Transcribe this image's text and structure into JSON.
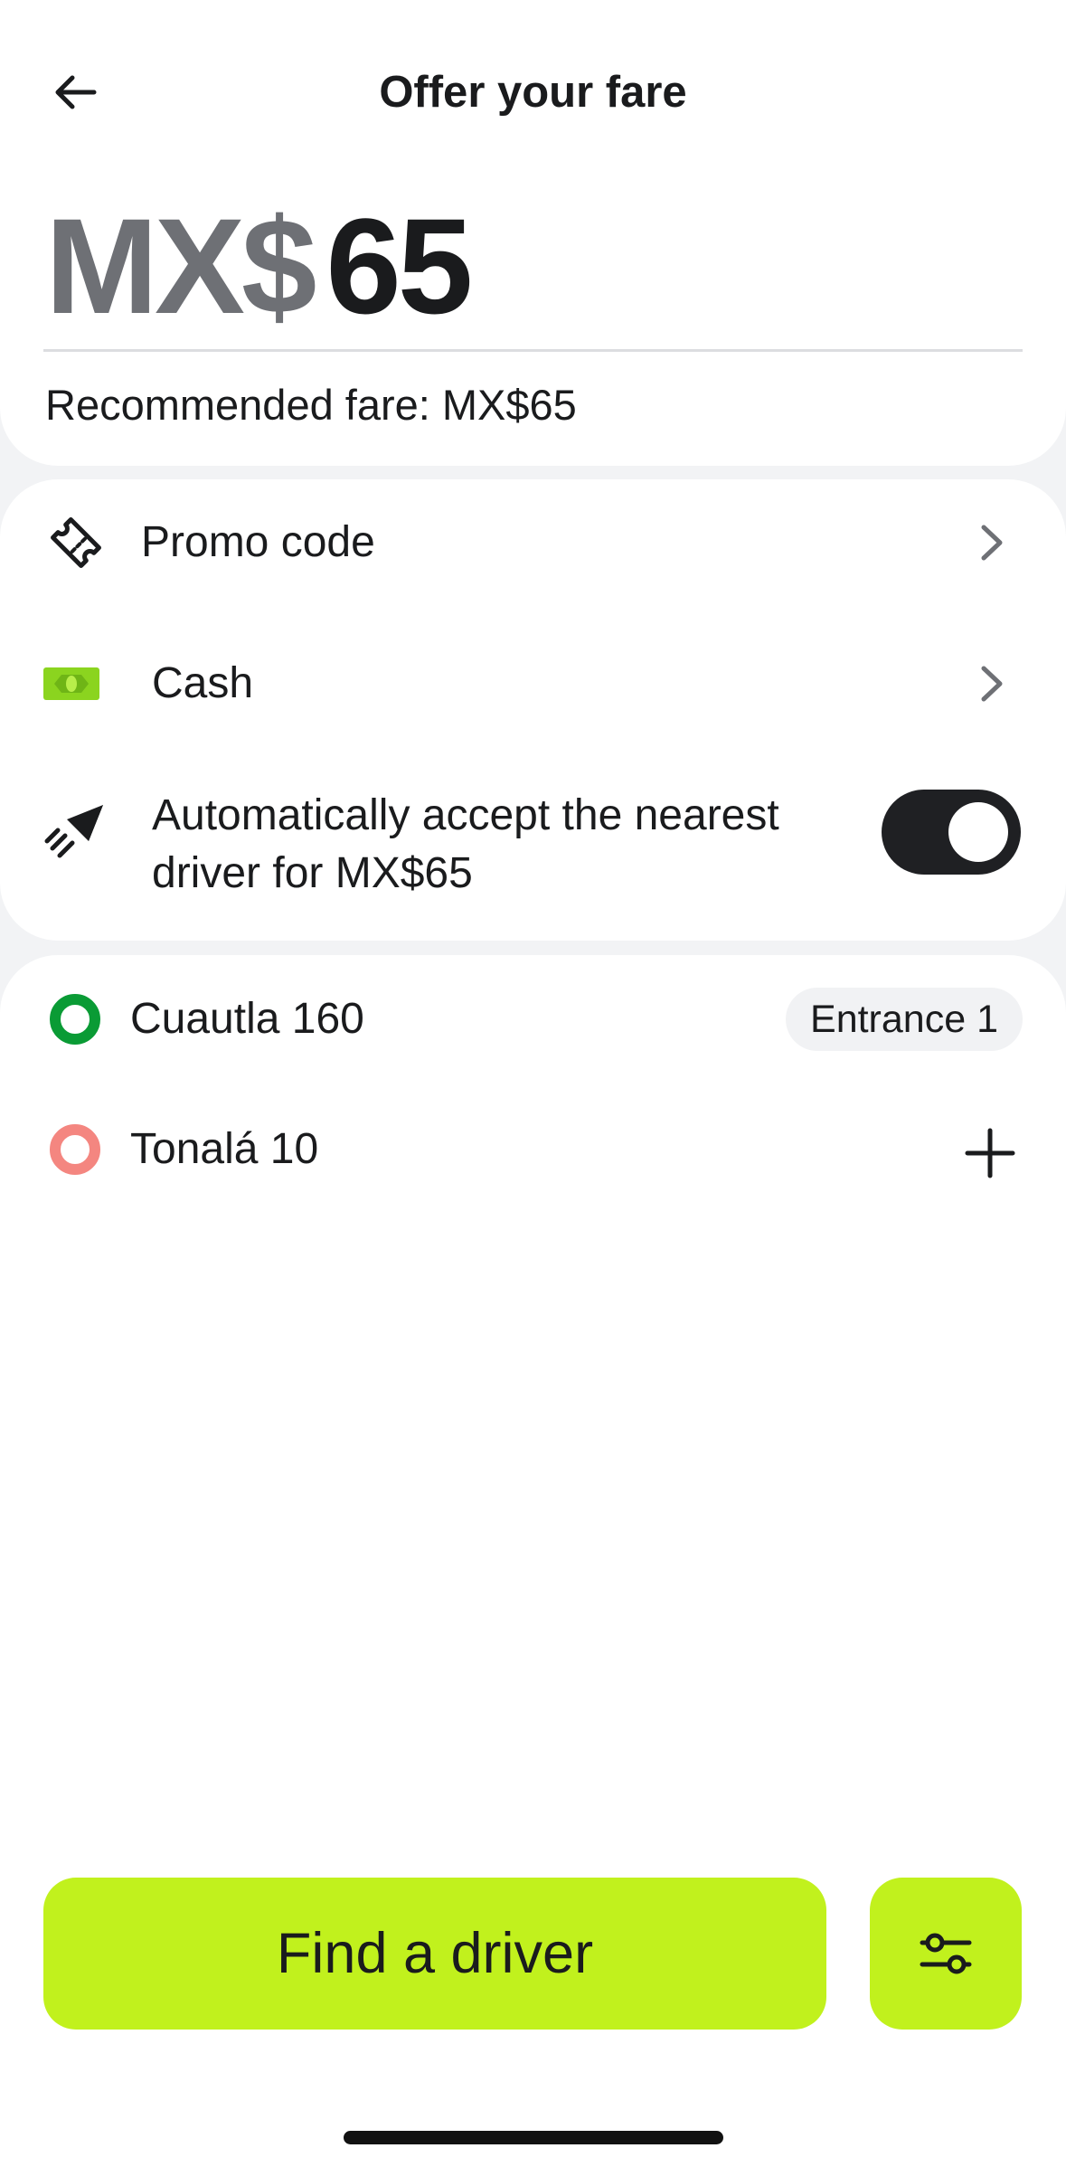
{
  "header": {
    "title": "Offer your fare",
    "back_icon": "arrow-left-icon"
  },
  "fare": {
    "currency": "MX$",
    "amount": "65",
    "recommended": "Recommended fare: MX$65"
  },
  "options": [
    {
      "icon": "ticket-icon",
      "label": "Promo code"
    },
    {
      "icon": "cash-icon",
      "label": "Cash"
    }
  ],
  "auto_accept": {
    "icon": "paper-plane-icon",
    "line1": "Automatically accept the nearest",
    "line2": "driver for MX$65",
    "enabled": true
  },
  "route": {
    "pickup": {
      "label": "Cuautla 160",
      "chip": "Entrance 1",
      "color": "#0a9b35"
    },
    "destination": {
      "label": "Tonalá 10",
      "color": "#f48680",
      "action_icon": "plus-icon"
    }
  },
  "actions": {
    "primary": "Find a driver",
    "settings_icon": "sliders-icon"
  },
  "colors": {
    "accent": "#c1f11d",
    "cash_green": "#8bd41f",
    "text": "#1a1b1d"
  }
}
